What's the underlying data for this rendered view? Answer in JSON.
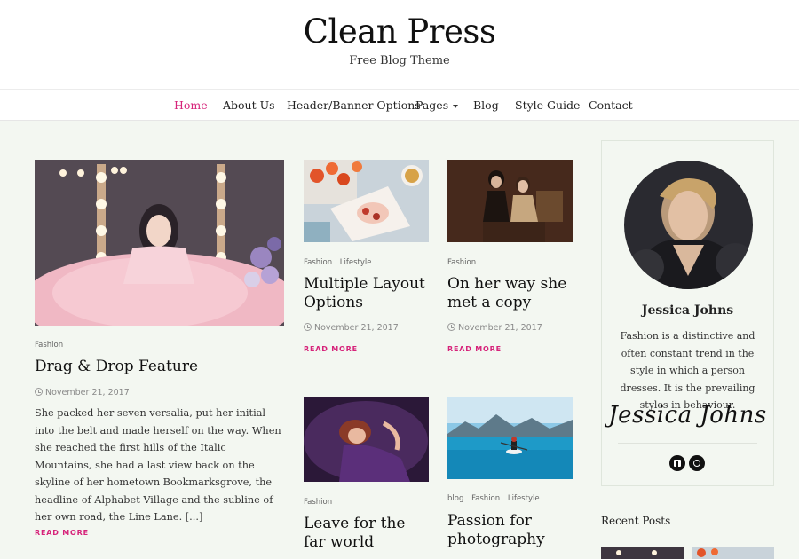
{
  "site": {
    "title": "Clean Press",
    "tagline": "Free Blog Theme"
  },
  "nav": {
    "items": [
      {
        "label": "Home",
        "active": true
      },
      {
        "label": "About Us"
      },
      {
        "label": "Header/Banner Options"
      },
      {
        "label": "Pages",
        "dropdown": true
      },
      {
        "label": "Blog"
      },
      {
        "label": "Style Guide"
      },
      {
        "label": "Contact"
      }
    ]
  },
  "featured": {
    "categories": [
      "Fashion"
    ],
    "title": "Drag & Drop Feature",
    "date": "November 21, 2017",
    "excerpt": "She packed her seven versalia, put her initial into the belt and made herself on the way. When she reached the first hills of the Italic Mountains, she had a last view back on the skyline of her hometown Bookmarksgrove, the headline of Alphabet Village and the subline of her own road, the Line Lane. [...]",
    "read_more": "READ MORE"
  },
  "posts": [
    {
      "categories": [
        "Fashion",
        "Lifestyle"
      ],
      "title": "Multiple Layout Options",
      "date": "November 21, 2017",
      "read_more": "READ MORE"
    },
    {
      "categories": [
        "Fashion"
      ],
      "title": "On her way she met a copy",
      "date": "November 21, 2017",
      "read_more": "READ MORE"
    },
    {
      "categories": [
        "Fashion"
      ],
      "title": "Leave for the far world"
    },
    {
      "categories": [
        "blog",
        "Fashion",
        "Lifestyle"
      ],
      "title": "Passion for photography"
    }
  ],
  "sidebar": {
    "author_name": "Jessica Johns",
    "bio": "Fashion is a distinctive and often constant trend in the style in which a person dresses. It is the prevailing styles in behaviour.",
    "signature": "Jessica Johns",
    "social_icons": [
      "facebook-icon",
      "instagram-icon"
    ],
    "recent_posts_title": "Recent Posts"
  },
  "colors": {
    "accent": "#d6237a",
    "background": "#f3f7f1"
  }
}
